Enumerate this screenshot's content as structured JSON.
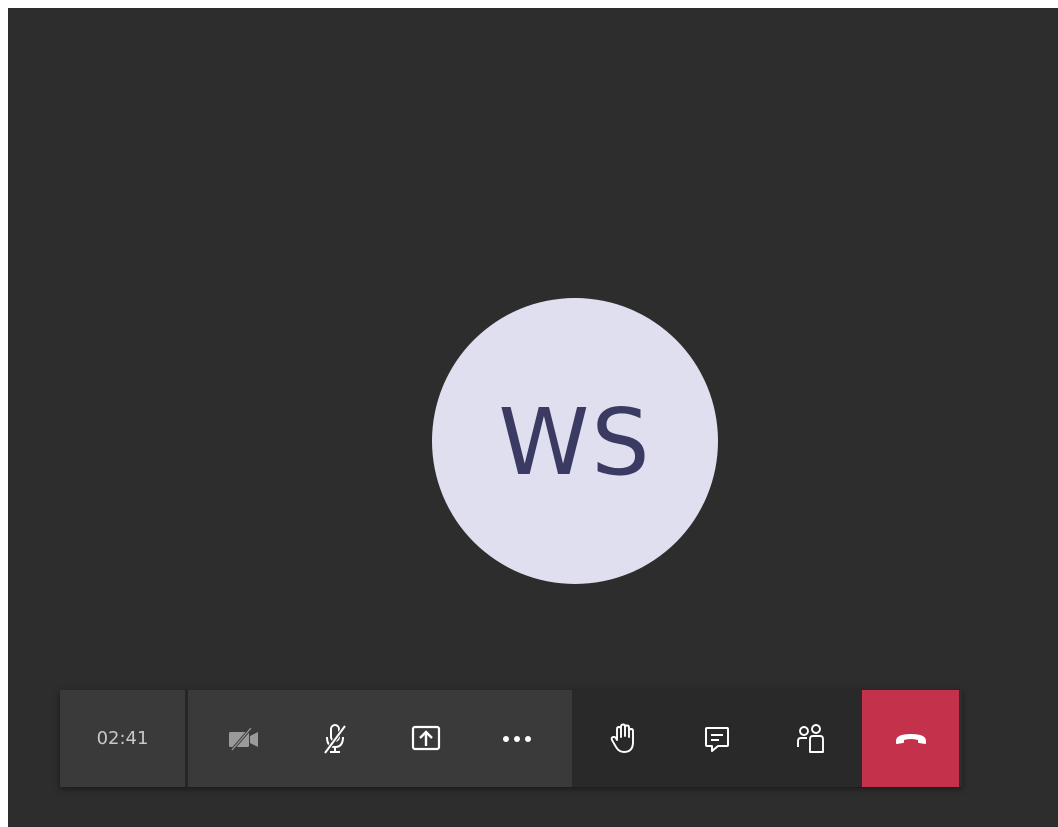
{
  "participant": {
    "initials": "WS"
  },
  "call": {
    "duration": "02:41"
  },
  "icons": {
    "camera": "camera-off-icon",
    "microphone": "microphone-off-icon",
    "share": "share-screen-icon",
    "more": "more-options-icon",
    "raise_hand": "raise-hand-icon",
    "chat": "chat-icon",
    "participants": "participants-icon",
    "hang_up": "hang-up-icon"
  },
  "colors": {
    "stage_background": "#2d2d2d",
    "avatar_background": "#e0dff0",
    "avatar_text": "#3b3a63",
    "toolbar_background": "#3a3a3a",
    "toolbar_aux_background": "#292929",
    "hang_up": "#c4314b",
    "icon": "#ffffff",
    "icon_muted": "#9a9a9a"
  }
}
